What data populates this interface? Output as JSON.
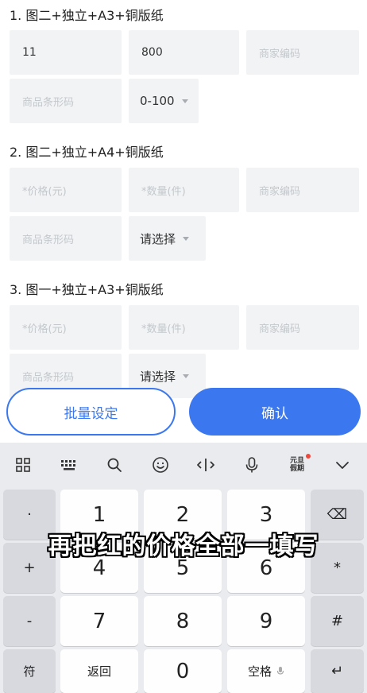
{
  "sections": [
    {
      "title": "1. 图二+独立+A3+铜版纸",
      "price": "11",
      "qty": "800",
      "merchant_code_ph": "商家编码",
      "barcode_ph": "商品条形码",
      "select": "0-100"
    },
    {
      "title": "2. 图二+独立+A4+铜版纸",
      "price_ph": "*价格(元)",
      "qty_ph": "*数量(件)",
      "merchant_code_ph": "商家编码",
      "barcode_ph": "商品条形码",
      "select": "请选择"
    },
    {
      "title": "3. 图一+独立+A3+铜版纸",
      "price_ph": "*价格(元)",
      "qty_ph": "*数量(件)",
      "merchant_code_ph": "商家编码",
      "barcode_ph": "商品条形码",
      "select": "请选择"
    }
  ],
  "buttons": {
    "batch": "批量设定",
    "confirm": "确认"
  },
  "keyboard": {
    "toolbar_badge": "元旦\n假期",
    "left_keys": [
      "·",
      "+",
      "-",
      "符"
    ],
    "digits": [
      "1",
      "2",
      "3",
      "4",
      "5",
      "6",
      "7",
      "8",
      "9",
      "0"
    ],
    "right_keys": [
      "⌫",
      "*",
      "#",
      "↵"
    ],
    "back": "返回",
    "space": "空格"
  },
  "caption": "再把红的价格全部一填写"
}
